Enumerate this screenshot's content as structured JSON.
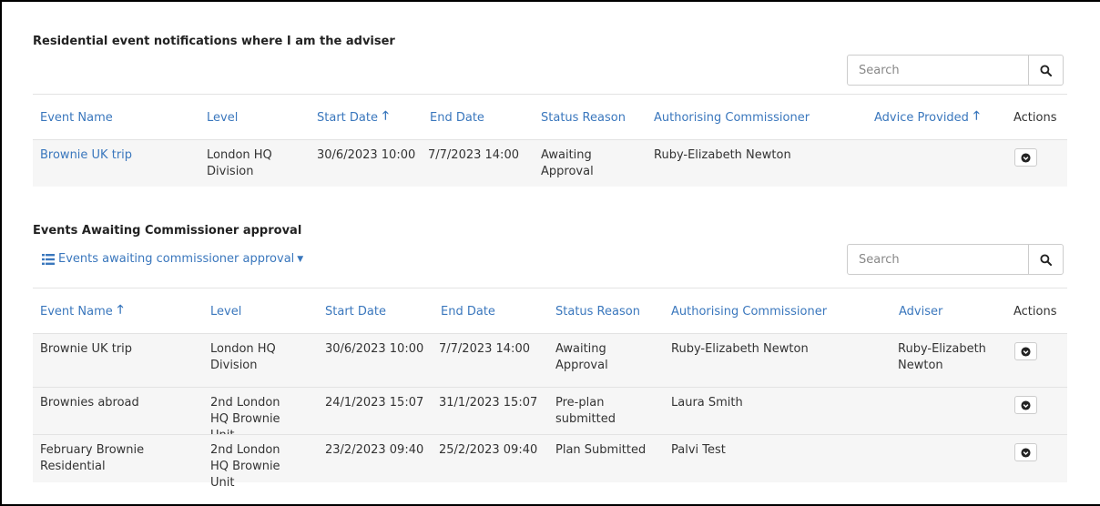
{
  "section1": {
    "title": "Residential event notifications where I am the adviser",
    "search_placeholder": "Search",
    "columns": [
      "Event Name",
      "Level",
      "Start Date",
      "End Date",
      "Status Reason",
      "Authorising Commissioner",
      "Advice Provided",
      "Actions"
    ],
    "rows": [
      {
        "event_name": "Brownie UK trip",
        "level": "London HQ Division",
        "start_date": "30/6/2023 10:00",
        "end_date": "7/7/2023 14:00",
        "status_reason": "Awaiting Approval",
        "commissioner": "Ruby-Elizabeth Newton",
        "advice_provided": ""
      }
    ]
  },
  "section2": {
    "title": "Events Awaiting Commissioner approval",
    "view_selector": "Events awaiting commissioner approval",
    "search_placeholder": "Search",
    "columns": [
      "Event Name",
      "Level",
      "Start Date",
      "End Date",
      "Status Reason",
      "Authorising Commissioner",
      "Adviser",
      "Actions"
    ],
    "rows": [
      {
        "event_name": "Brownie UK trip",
        "level": "London HQ Division",
        "start_date": "30/6/2023 10:00",
        "end_date": "7/7/2023 14:00",
        "status_reason": "Awaiting Approval",
        "commissioner": "Ruby-Elizabeth Newton",
        "adviser": "Ruby-Elizabeth Newton"
      },
      {
        "event_name": "Brownies abroad",
        "level": "2nd London HQ Brownie Unit",
        "start_date": "24/1/2023 15:07",
        "end_date": "31/1/2023 15:07",
        "status_reason": "Pre-plan submitted",
        "commissioner": "Laura Smith",
        "adviser": ""
      },
      {
        "event_name": "February Brownie Residential",
        "level": "2nd London HQ Brownie Unit",
        "start_date": "23/2/2023 09:40",
        "end_date": "25/2/2023 09:40",
        "status_reason": "Plan Submitted",
        "commissioner": "Palvi Test",
        "adviser": ""
      }
    ]
  },
  "icons": {
    "search": "search-icon",
    "sort_asc": "arrow-up-icon",
    "actions": "chevron-circle-down-icon",
    "list": "list-icon",
    "caret": "caret-down-icon"
  },
  "colors": {
    "link": "#3a77bd",
    "row_bg": "#f6f6f6",
    "border": "#e3e3e3"
  }
}
